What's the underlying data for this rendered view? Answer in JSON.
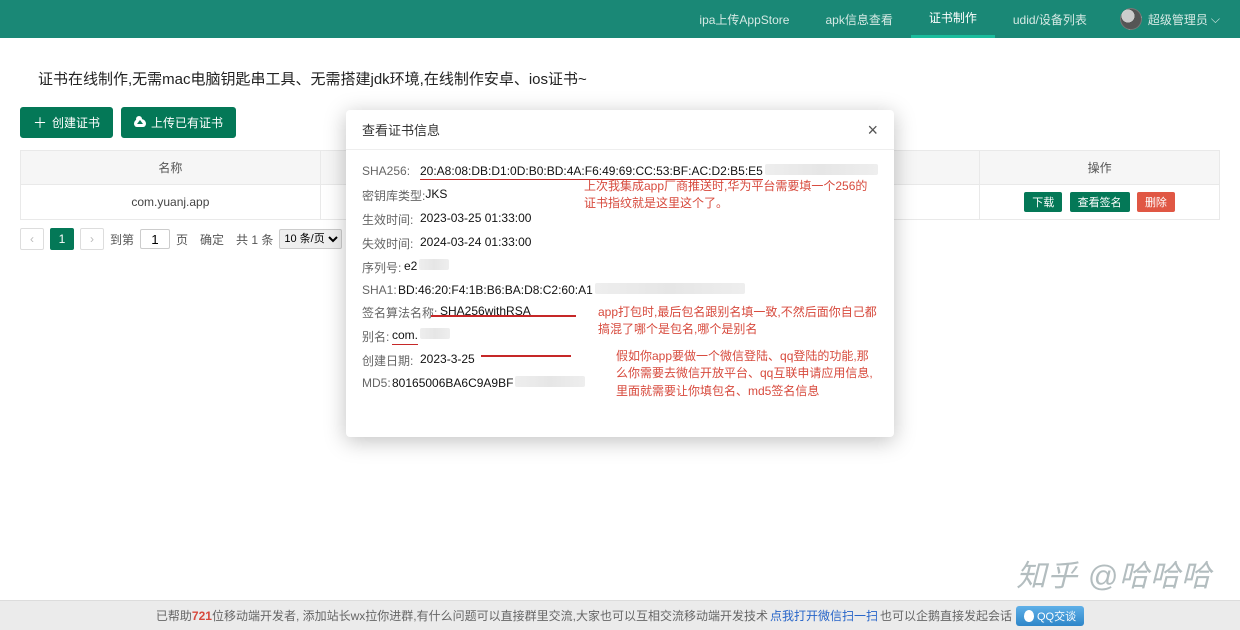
{
  "nav": {
    "items": [
      {
        "label": "ipa上传AppStore"
      },
      {
        "label": "apk信息查看"
      },
      {
        "label": "证书制作"
      },
      {
        "label": "udid/设备列表"
      }
    ],
    "user": "超级管理员"
  },
  "page": {
    "title": "证书在线制作,无需mac电脑钥匙串工具、无需搭建jdk环境,在线制作安卓、ios证书~",
    "create_btn": "创建证书",
    "upload_btn": "上传已有证书"
  },
  "table": {
    "headers": [
      "名称",
      "操作"
    ],
    "row": {
      "name": "com.yuanj.app",
      "download": "下载",
      "view": "查看签名",
      "delete": "删除"
    }
  },
  "pager": {
    "prev": "‹",
    "page": "1",
    "next": "›",
    "goto": "到第",
    "page_unit": "页",
    "confirm": "确定",
    "total": "共 1 条",
    "page_size": "10 条/页"
  },
  "modal": {
    "title": "查看证书信息",
    "rows": {
      "sha256_label": "SHA256:",
      "sha256_val": "20:A8:08:DB:D1:0D:B0:BD:4A:F6:49:69:CC:53:BF:AC:D2:B5:E5",
      "keystore_label": "密钥库类型:",
      "keystore_val": "JKS",
      "start_label": "生效时间:",
      "start_val": "2023-03-25 01:33:00",
      "end_label": "失效时间:",
      "end_val": "2024-03-24 01:33:00",
      "serial_label": "序列号:",
      "serial_val": "e2",
      "sha1_label": "SHA1:",
      "sha1_val": "BD:46:20:F4:1B:B6:BA:D8:C2:60:A1",
      "algo_label": "签名算法名称:",
      "algo_val": "SHA256withRSA",
      "alias_label": "别名:",
      "alias_val": "com.",
      "create_label": "创建日期:",
      "create_val": "2023-3-25",
      "md5_label": "MD5:",
      "md5_val": "80165006BA6C9A9BF"
    },
    "notes": {
      "n1": "上次我集成app厂商推送时,华为平台需要填一个256的证书指纹就是这里这个了。",
      "n2": "app打包时,最后包名跟别名填一致,不然后面你自己都搞混了哪个是包名,哪个是别名",
      "n3": "假如你app要做一个微信登陆、qq登陆的功能,那么你需要去微信开放平台、qq互联申请应用信息,里面就需要让你填包名、md5签名信息"
    }
  },
  "footer": {
    "p1": "已帮助",
    "num": "721",
    "p2": "位移动端开发者, 添加站长wx拉你进群,有什么问题可以直接群里交流,大家也可以互相交流移动端开发技术 ",
    "link": "点我打开微信扫一扫",
    "p3": "   也可以企鹅直接发起会话 ",
    "qq": "QQ交谈"
  },
  "watermark": "知乎 @哈哈哈"
}
